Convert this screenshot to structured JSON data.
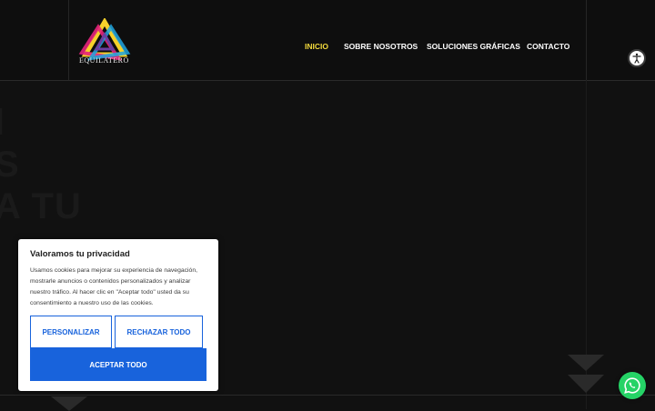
{
  "header": {
    "logo_text": "EQUILATERO",
    "nav": [
      {
        "label": "INICIO",
        "active": true
      },
      {
        "label": "SOBRE NOSOTROS",
        "active": false
      },
      {
        "label": "SOLUCIONES GRÁFICAS",
        "active": false
      },
      {
        "label": "CONTACTO",
        "active": false
      }
    ]
  },
  "hero": {
    "ghost_lines": [
      "l",
      "S",
      "A TU"
    ]
  },
  "cookie_banner": {
    "title": "Valoramos tu privacidad",
    "text": "Usamos cookies para mejorar su experiencia de navegación, mostrarle anuncios o contenidos personalizados y analizar nuestro tráfico. Al hacer clic en \"Aceptar todo\" usted da su consentimiento a nuestro uso de las cookies.",
    "customize_label": "PERSONALIZAR",
    "reject_label": "RECHAZAR TODO",
    "accept_label": "ACEPTAR TODO"
  },
  "colors": {
    "background": "#111111",
    "nav_active": "#f2d93c",
    "accent_blue": "#1863dc",
    "whatsapp": "#25d366"
  },
  "icons": {
    "accessibility": "accessibility-icon",
    "whatsapp": "whatsapp-icon"
  }
}
